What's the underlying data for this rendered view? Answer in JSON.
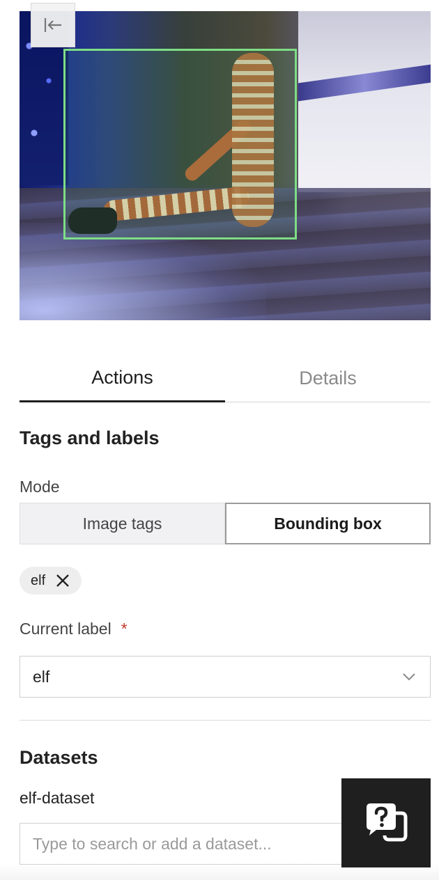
{
  "image": {
    "bounding_box_label": "elf",
    "bounding_box_color": "#7ede86"
  },
  "collapse_button": {
    "icon": "arrow-left-to-line-icon"
  },
  "tabs": [
    {
      "label": "Actions",
      "active": true
    },
    {
      "label": "Details",
      "active": false
    }
  ],
  "tags_and_labels": {
    "title": "Tags and labels",
    "mode": {
      "label": "Mode",
      "options": [
        "Image tags",
        "Bounding box"
      ],
      "selected": "Bounding box"
    },
    "chips": [
      {
        "label": "elf",
        "remove_icon": "close-icon"
      }
    ],
    "current_label": {
      "label": "Current label",
      "required_marker": "*",
      "value": "elf",
      "icon": "chevron-down-icon"
    }
  },
  "datasets": {
    "title": "Datasets",
    "items": [
      "elf-dataset"
    ],
    "search_placeholder": "Type to search or add a dataset..."
  },
  "help_button": {
    "icon": "help-chat-icon"
  },
  "colors": {
    "required": "#c0392b",
    "help_bg": "#1f1f1f"
  }
}
